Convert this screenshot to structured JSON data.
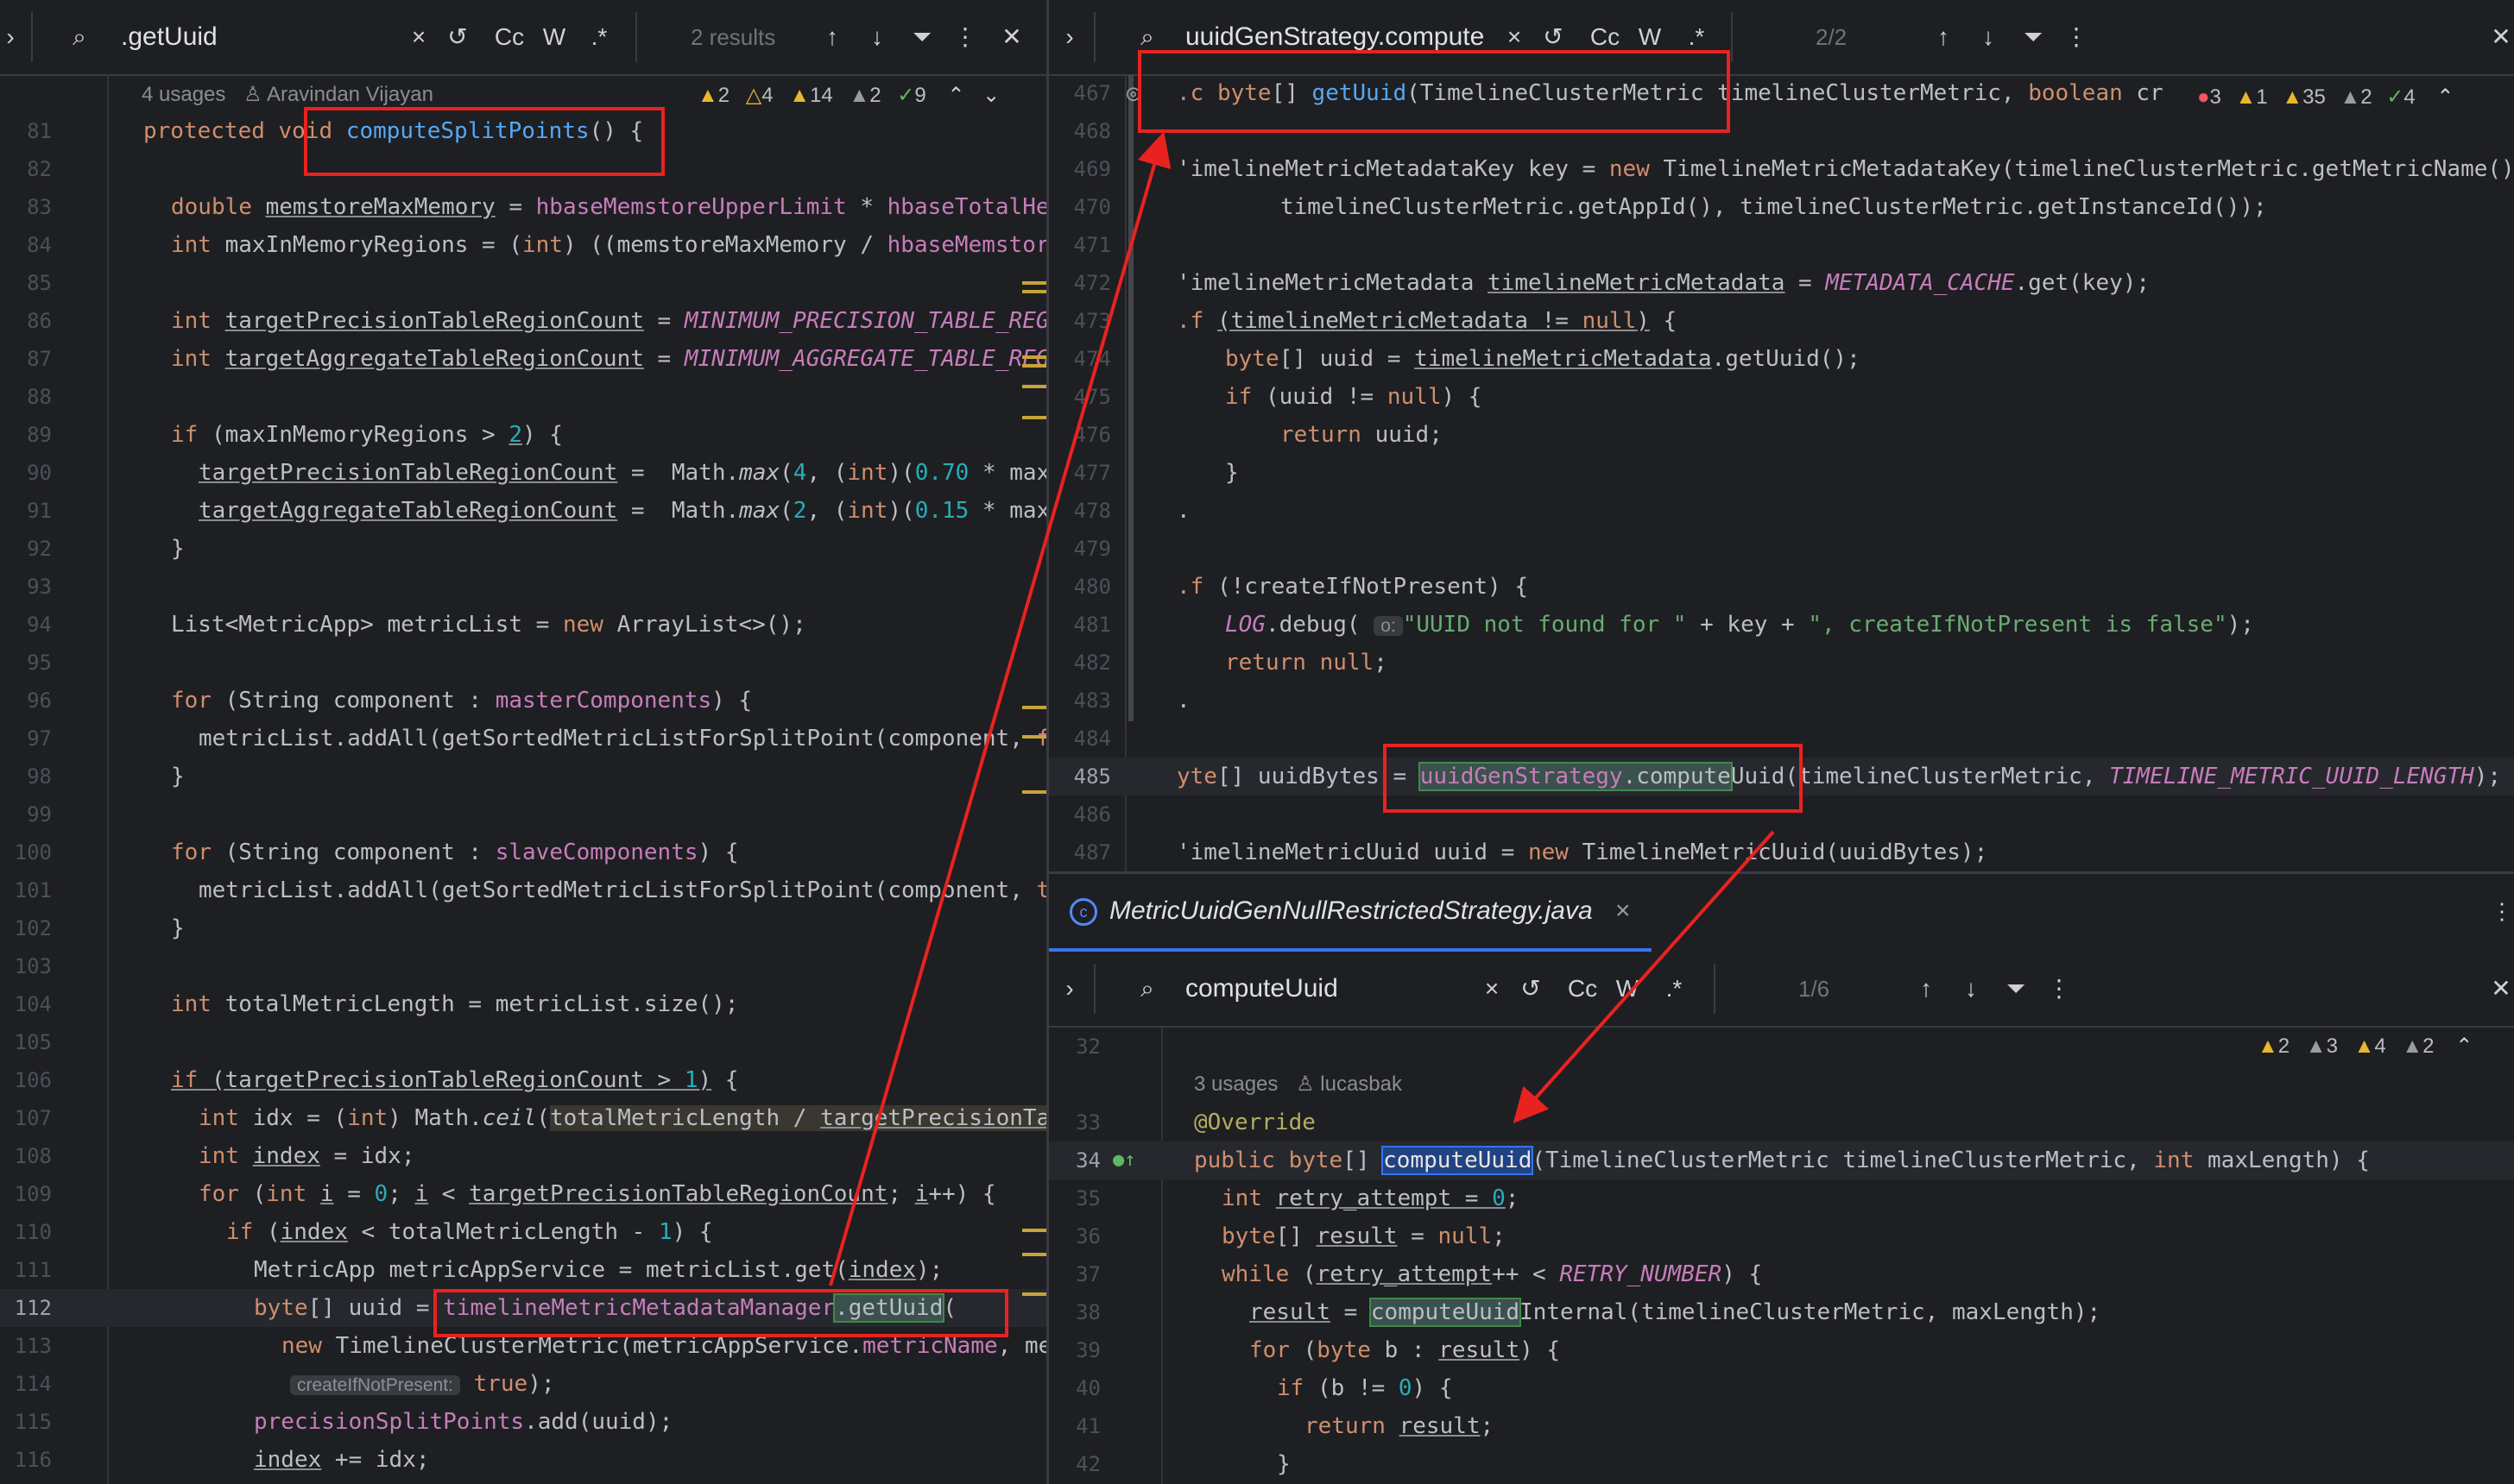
{
  "left_find": {
    "query": ".getUuid",
    "results": "2 results"
  },
  "right_find": {
    "query": "uuidGenStrategy.compute",
    "results": "2/2"
  },
  "bottom_find": {
    "query": "computeUuid",
    "results": "1/6"
  },
  "find_icons": {
    "match_case": "Cc",
    "words": "W",
    "regex": ".*"
  },
  "left_meta": {
    "usages": "4 usages",
    "author": "Aravindan Vijayan"
  },
  "left_insp": {
    "a": "2",
    "b": "4",
    "c": "14",
    "d": "2",
    "e": "9"
  },
  "right_insp": {
    "a": "3",
    "b": "1",
    "c": "35",
    "d": "2",
    "e": "4"
  },
  "bottom_insp": {
    "a": "2",
    "b": "3",
    "c": "4",
    "d": "2"
  },
  "bottom_tab": "MetricUuidGenNullRestrictedStrategy.java",
  "bottom_meta": {
    "usages": "3 usages",
    "author": "lucasbak"
  },
  "hints": {
    "o": "o:",
    "create": "createIfNotPresent:"
  },
  "left_lines": [
    "81",
    "82",
    "83",
    "84",
    "85",
    "86",
    "87",
    "88",
    "89",
    "90",
    "91",
    "92",
    "93",
    "94",
    "95",
    "96",
    "97",
    "98",
    "99",
    "100",
    "101",
    "102",
    "103",
    "104",
    "105",
    "106",
    "107",
    "108",
    "109",
    "110",
    "111",
    "112",
    "113",
    "114",
    "115",
    "116"
  ],
  "right_lines": [
    "467",
    "468",
    "469",
    "470",
    "471",
    "472",
    "473",
    "474",
    "475",
    "476",
    "477",
    "478",
    "479",
    "480",
    "481",
    "482",
    "483",
    "484",
    "485",
    "486",
    "487"
  ],
  "bottom_lines": [
    "32",
    "33",
    "34",
    "35",
    "36",
    "37",
    "38",
    "39",
    "40",
    "41",
    "42"
  ],
  "colors": {
    "accent": "#3574f0",
    "annotation_box": "#e8231f",
    "bg": "#1e1f22"
  }
}
